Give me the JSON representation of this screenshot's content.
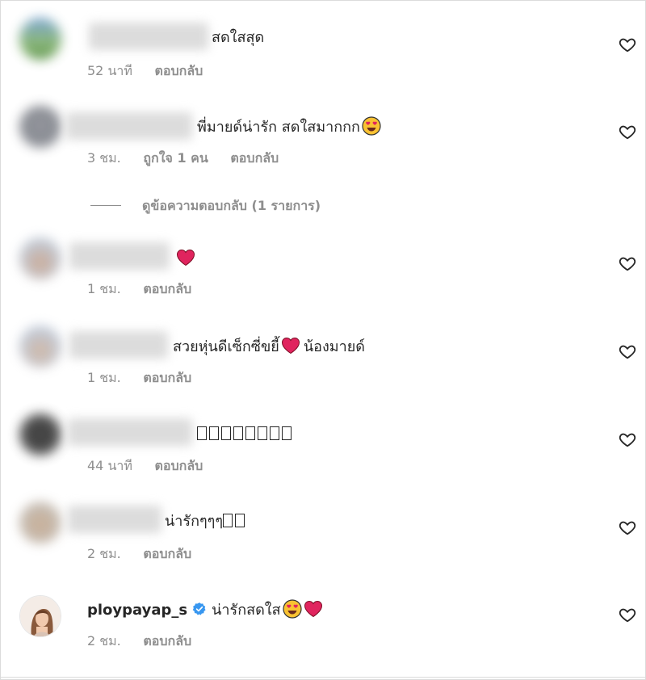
{
  "comments": [
    {
      "text": "สดใสสุด",
      "time": "52 นาที",
      "reply": "ตอบกลับ"
    },
    {
      "text": "พี่มายด์น่ารัก สดใสมากกก",
      "time": "3 ชม.",
      "likes": "ถูกใจ 1 คน",
      "reply": "ตอบกลับ",
      "view_replies": "ดูข้อความตอบกลับ (1 รายการ)"
    },
    {
      "text": "",
      "time": "1 ชม.",
      "reply": "ตอบกลับ"
    },
    {
      "text": "สวยหุ่นดีเซ็กซี่ขยี้",
      "text2": "น้องมายด์",
      "time": "1 ชม.",
      "reply": "ตอบกลับ"
    },
    {
      "text": "",
      "time": "44 นาที",
      "reply": "ตอบกลับ"
    },
    {
      "text": "น่ารักๆๆๆ",
      "time": "2 ชม.",
      "reply": "ตอบกลับ"
    },
    {
      "username": "ploypayap_s",
      "text": "น่ารักสดใส",
      "time": "2 ชม.",
      "reply": "ตอบกลับ"
    }
  ],
  "colors": {
    "heart": "#e0245e",
    "verified": "#3897f0",
    "meta": "#8e8e8e"
  },
  "icons": [
    "heart-outline-icon",
    "heart-emoji-icon",
    "heart-eyes-emoji-icon",
    "verified-badge-icon"
  ]
}
